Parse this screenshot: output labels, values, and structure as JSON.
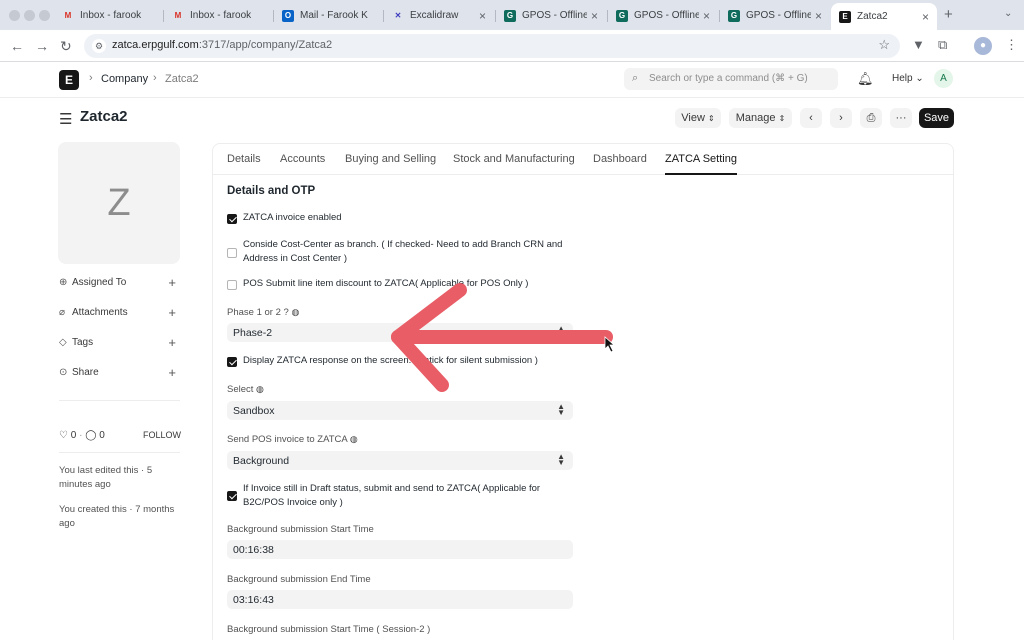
{
  "browser": {
    "tabs": [
      {
        "title": "Inbox - farook",
        "favicon": "gmail-icon"
      },
      {
        "title": "Inbox - farook",
        "favicon": "gmail-icon"
      },
      {
        "title": "Mail - Farook K",
        "favicon": "outlook-icon"
      },
      {
        "title": "Excalidraw",
        "favicon": "excalidraw-icon"
      },
      {
        "title": "GPOS - Offline",
        "favicon": "gpos-icon"
      },
      {
        "title": "GPOS - Offline",
        "favicon": "gpos-icon"
      },
      {
        "title": "GPOS - Offline",
        "favicon": "gpos-icon"
      },
      {
        "title": "Zatca2",
        "favicon": "erpnext-icon",
        "active": true
      }
    ],
    "url_host": "zatca.erpgulf.com",
    "url_path": ":3717/app/company/Zatca2"
  },
  "navbar": {
    "logo": "E",
    "breadcrumbs": [
      "Company",
      "Zatca2"
    ],
    "search_placeholder": "Search or type a command (⌘ + G)",
    "help_label": "Help",
    "avatar_letter": "A"
  },
  "page": {
    "title": "Zatca2",
    "view_label": "View",
    "manage_label": "Manage",
    "save_label": "Save"
  },
  "sidebar": {
    "image_letter": "Z",
    "items": [
      {
        "label": "Assigned To",
        "icon": "assign-icon"
      },
      {
        "label": "Attachments",
        "icon": "paperclip-icon"
      },
      {
        "label": "Tags",
        "icon": "tag-icon"
      },
      {
        "label": "Share",
        "icon": "share-icon"
      }
    ],
    "likes": "0",
    "comments": "0",
    "follow_label": "FOLLOW",
    "last_edited": "You last edited this · 5 minutes ago",
    "created": "You created this · 7 months ago"
  },
  "form": {
    "tabs": [
      "Details",
      "Accounts",
      "Buying and Selling",
      "Stock and Manufacturing",
      "Dashboard",
      "ZATCA Setting"
    ],
    "active_tab": "ZATCA Setting",
    "section_title": "Details and OTP",
    "zatca_enabled_label": "ZATCA invoice enabled",
    "zatca_enabled": true,
    "cost_center_label": "Conside Cost-Center as branch. ( If checked- Need to add Branch CRN and Address in Cost Center )",
    "cost_center": false,
    "pos_discount_label": "POS Submit line item discount to ZATCA( Applicable for POS Only )",
    "pos_discount": false,
    "phase_label": "Phase 1 or 2 ?",
    "phase_value": "Phase-2",
    "display_response_label": "Display ZATCA response on the screen. (Untick for silent submission )",
    "display_response": true,
    "select_label": "Select",
    "select_value": "Sandbox",
    "send_pos_label": "Send POS invoice to ZATCA",
    "send_pos_value": "Background",
    "draft_label": "If Invoice still in Draft status, submit and send to ZATCA( Applicable for B2C/POS Invoice only )",
    "draft": true,
    "bg_start_label": "Background submission Start Time",
    "bg_start_value": "00:16:38",
    "bg_end_label": "Background submission End Time",
    "bg_end_value": "03:16:43",
    "bg_start2_label": "Background submission Start Time ( Session-2 )"
  },
  "colors": {
    "annotation_arrow": "#e85d66",
    "primary": "#171717"
  }
}
